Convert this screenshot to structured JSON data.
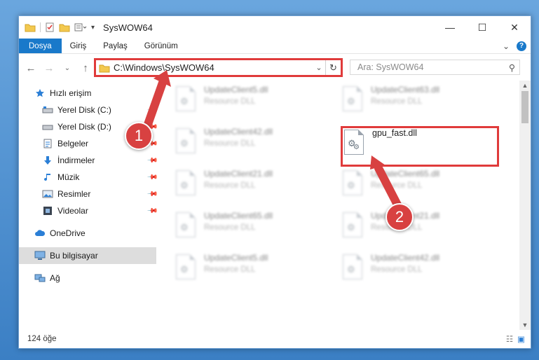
{
  "window": {
    "title": "SysWOW64",
    "controls": {
      "minimize": "—",
      "maximize": "☐",
      "close": "✕"
    }
  },
  "ribbon": {
    "tabs": [
      "Dosya",
      "Giriş",
      "Paylaş",
      "Görünüm"
    ],
    "expand": "⌄",
    "help": "?"
  },
  "nav": {
    "back": "←",
    "forward": "→",
    "recent": "⌄",
    "up": "↑",
    "address": "C:\\Windows\\SysWOW64",
    "dropdown": "⌄",
    "refresh": "↻",
    "search_placeholder": "Ara: SysWOW64",
    "search_icon": "⚲"
  },
  "sidebar": {
    "items": [
      {
        "label": "Hızlı erişim",
        "icon": "star-icon",
        "top": true
      },
      {
        "label": "Yerel Disk (C:)",
        "icon": "drive-icon",
        "pinned": true
      },
      {
        "label": "Yerel Disk (D:)",
        "icon": "drive-icon",
        "pinned": true
      },
      {
        "label": "Belgeler",
        "icon": "documents-icon",
        "pinned": true
      },
      {
        "label": "İndirmeler",
        "icon": "download-icon",
        "pinned": true
      },
      {
        "label": "Müzik",
        "icon": "music-icon",
        "pinned": true
      },
      {
        "label": "Resimler",
        "icon": "pictures-icon",
        "pinned": true
      },
      {
        "label": "Videolar",
        "icon": "videos-icon",
        "pinned": true
      },
      {
        "label": "OneDrive",
        "icon": "cloud-icon",
        "top": true
      },
      {
        "label": "Bu bilgisayar",
        "icon": "computer-icon",
        "top": true,
        "selected": true
      },
      {
        "label": "Ağ",
        "icon": "network-icon",
        "top": true
      }
    ]
  },
  "files": {
    "left": [
      {
        "name": "UpdateClient5.dll",
        "type": "Resource DLL"
      },
      {
        "name": "UpdateClient42.dll",
        "type": "Resource DLL"
      },
      {
        "name": "UpdateClient21.dll",
        "type": "Resource DLL"
      },
      {
        "name": "UpdateClient65.dll",
        "type": "Resource DLL"
      },
      {
        "name": "UpdateClient5.dll",
        "type": "Resource DLL"
      }
    ],
    "right": [
      {
        "name": "UpdateClient63.dll",
        "type": "Resource DLL"
      },
      {
        "name": "gpu_fast.dll",
        "type": "",
        "highlighted": true
      },
      {
        "name": "UpdateClient65.dll",
        "type": "Resource DLL"
      },
      {
        "name": "UpdateClient21.dll",
        "type": "Resource DLL"
      },
      {
        "name": "UpdateClient42.dll",
        "type": "Resource DLL"
      }
    ]
  },
  "status": {
    "count": "124 öğe"
  },
  "annotations": {
    "step1": "1",
    "step2": "2",
    "color": "#d84141"
  }
}
